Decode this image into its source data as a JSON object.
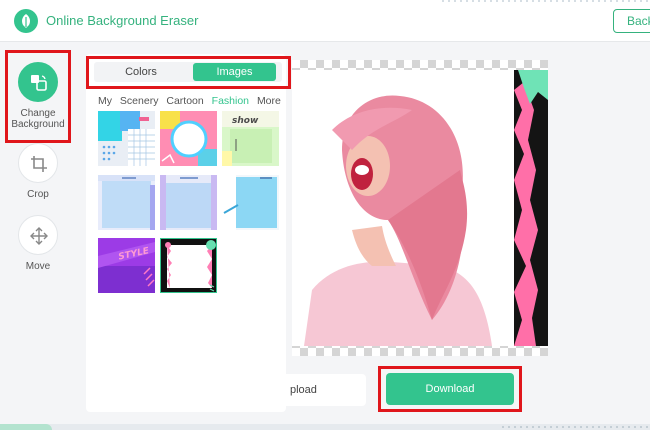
{
  "app": {
    "title": "Online Background Eraser",
    "back_label": "Back"
  },
  "tools": [
    {
      "label": "Change Background",
      "icon": "change-background-icon",
      "active": true
    },
    {
      "label": "Crop",
      "icon": "crop-icon",
      "active": false
    },
    {
      "label": "Move",
      "icon": "move-icon",
      "active": false
    }
  ],
  "panel": {
    "tabs": [
      {
        "label": "Colors",
        "selected": false
      },
      {
        "label": "Images",
        "selected": true
      }
    ],
    "categories": [
      {
        "label": "My",
        "active": false
      },
      {
        "label": "Scenery",
        "active": false
      },
      {
        "label": "Cartoon",
        "active": false
      },
      {
        "label": "Fashion",
        "active": true
      },
      {
        "label": "More",
        "active": false
      }
    ],
    "thumbnails": [
      {
        "name": "fashion-bg-1",
        "text": ""
      },
      {
        "name": "fashion-bg-2",
        "text": ""
      },
      {
        "name": "fashion-bg-3",
        "text": "show"
      },
      {
        "name": "fashion-bg-4",
        "text": ""
      },
      {
        "name": "fashion-bg-5",
        "text": ""
      },
      {
        "name": "fashion-bg-6",
        "text": ""
      },
      {
        "name": "fashion-bg-7",
        "text": "STYLE"
      },
      {
        "name": "fashion-bg-8",
        "text": "",
        "selected": true
      }
    ]
  },
  "actions": {
    "upload_label": "pload",
    "download_label": "Download"
  },
  "colors": {
    "accent": "#33c48e",
    "highlight": "#e0161b"
  }
}
